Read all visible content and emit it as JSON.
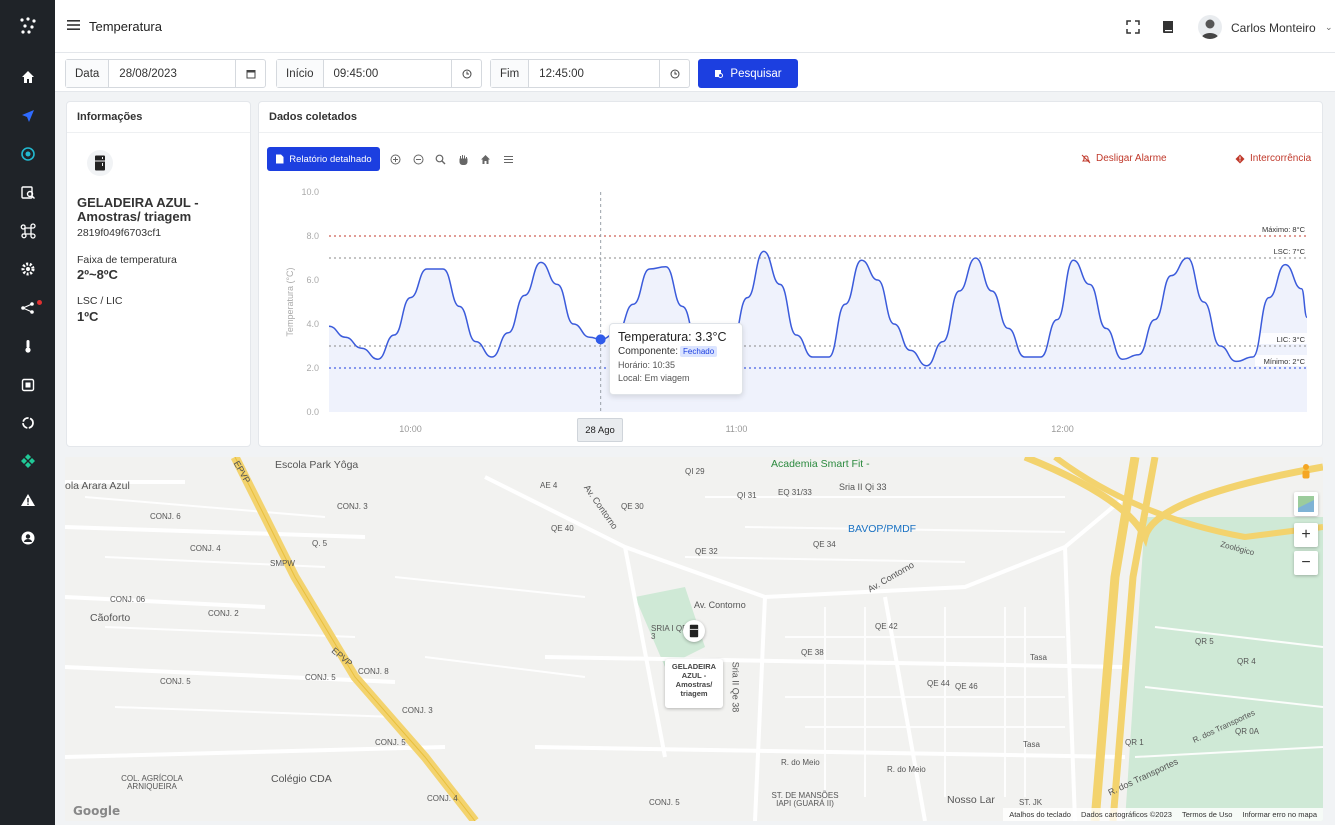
{
  "header": {
    "title": "Temperatura",
    "user_name": "Carlos Monteiro"
  },
  "filters": {
    "date_label": "Data",
    "date_value": "28/08/2023",
    "start_label": "Início",
    "start_value": "09:45:00",
    "end_label": "Fim",
    "end_value": "12:45:00",
    "search_label": "Pesquisar"
  },
  "info": {
    "title": "Informações",
    "device_name": "GELADEIRA AZUL - Amostras/ triagem",
    "device_id": "2819f049f6703cf1",
    "range_label": "Faixa de temperatura",
    "range_value": "2º~8ºC",
    "lsc_label": "LSC / LIC",
    "lsc_value": "1ºC"
  },
  "collected": {
    "title": "Dados coletados",
    "report_label": "Relatório detalhado",
    "alarm_off_label": "Desligar Alarme",
    "incident_label": "Intercorrência"
  },
  "tooltip": {
    "title": "Temperatura: 3.3°C",
    "component_label": "Componente:",
    "component_value": "Fechado",
    "time": "Horário: 10:35",
    "location": "Local: Em viagem"
  },
  "crosshair_label": "28 Ago",
  "chart_data": {
    "type": "area",
    "ylabel": "Temperatura (°C)",
    "ylim": [
      0,
      10
    ],
    "yticks": [
      "10.0",
      "8.0",
      "6.0",
      "4.0",
      "2.0",
      "0.0"
    ],
    "xticks": [
      "10:00",
      "11:00",
      "12:00"
    ],
    "x_minutes_from": "09:45",
    "thresholds": [
      {
        "label": "Máximo: 8°C",
        "value": 8,
        "color": "#c0392b"
      },
      {
        "label": "LSC: 7°C",
        "value": 7,
        "color": "#888888"
      },
      {
        "label": "LIC: 3°C",
        "value": 3,
        "color": "#888888"
      },
      {
        "label": "Mínimo: 2°C",
        "value": 2,
        "color": "#1c3fe0"
      }
    ],
    "series": [
      {
        "name": "Temperatura",
        "color": "#3b5bdb",
        "x": [
          "09:45",
          "09:48",
          "09:51",
          "09:54",
          "09:57",
          "10:00",
          "10:03",
          "10:06",
          "10:09",
          "10:12",
          "10:15",
          "10:18",
          "10:21",
          "10:24",
          "10:27",
          "10:30",
          "10:33",
          "10:35",
          "10:38",
          "10:41",
          "10:44",
          "10:47",
          "10:50",
          "10:53",
          "10:56",
          "10:59",
          "11:02",
          "11:05",
          "11:08",
          "11:11",
          "11:14",
          "11:17",
          "11:20",
          "11:23",
          "11:26",
          "11:29",
          "11:32",
          "11:35",
          "11:38",
          "11:41",
          "11:44",
          "11:47",
          "11:50",
          "11:53",
          "11:56",
          "11:59",
          "12:02",
          "12:05",
          "12:08",
          "12:11",
          "12:14",
          "12:17",
          "12:20",
          "12:23",
          "12:26",
          "12:29",
          "12:32",
          "12:35",
          "12:38",
          "12:41",
          "12:44",
          "12:45"
        ],
        "values": [
          3.9,
          3.4,
          2.9,
          2.4,
          3.5,
          5.2,
          6.5,
          6.5,
          4.8,
          3.2,
          2.5,
          3.6,
          5.3,
          6.8,
          5.8,
          4.0,
          3.4,
          3.3,
          3.6,
          4.9,
          6.5,
          6.6,
          4.8,
          3.0,
          2.4,
          3.0,
          5.2,
          7.3,
          5.8,
          3.5,
          2.5,
          2.5,
          4.9,
          6.9,
          6.0,
          4.0,
          2.8,
          2.1,
          3.2,
          5.5,
          7.0,
          5.5,
          3.8,
          2.5,
          2.5,
          4.2,
          6.9,
          5.8,
          3.8,
          2.4,
          2.6,
          4.2,
          6.2,
          7.0,
          5.0,
          3.0,
          2.3,
          2.5,
          5.2,
          6.7,
          5.6,
          4.3
        ]
      }
    ]
  },
  "map": {
    "marker_label": "GELADEIRA AZUL - Amostras/ triagem",
    "labels": [
      "CONJ. 6",
      "CONJ. 4",
      "CONJ. 06",
      "CONJ. 2",
      "CONJ. 3",
      "Q. 5",
      "SMPW",
      "CONJ. 8",
      "CONJ. 5",
      "CONJ. 3",
      "CONJ. 5",
      "CONJ. 5",
      "COL. AGRÍCOLA ARNIQUEIRA",
      "CONJ. 4",
      "CONJ. 5",
      "QI 29",
      "AE 4",
      "QI 31",
      "EQ 31/33",
      "QE 30",
      "QE 40",
      "QE 32",
      "QE 34",
      "QE 42",
      "QE 38",
      "QE 44",
      "QE 46",
      "QR 5",
      "QR 4",
      "QR 1",
      "QR 0A",
      "ST. DE MANSÕES IAPI (GUARÁ II)",
      "ST. JK",
      "SRIA I QE 3",
      "Tasa",
      "Tasa",
      "R. do Meio",
      "R. do Meio"
    ],
    "pois": [
      "Escola Park Yôga",
      "ola Arara Azul",
      "Cãoforto",
      "Colégio CDA",
      "Academia Smart Fit -",
      "BAVOP/PMDF",
      "Nosso Lar"
    ],
    "roads": [
      "Av. Contorno",
      "Av. Contorno",
      "Av. Contorno",
      "Sria II Qi 33",
      "Sria II Qe 38",
      "EPVP",
      "EPVP",
      "R. dos Transportes",
      "R. dos Transportes",
      "Zoológico"
    ],
    "footer": [
      "Atalhos do teclado",
      "Dados cartográficos ©2023",
      "Termos de Uso",
      "Informar erro no mapa"
    ],
    "google": "Google"
  }
}
